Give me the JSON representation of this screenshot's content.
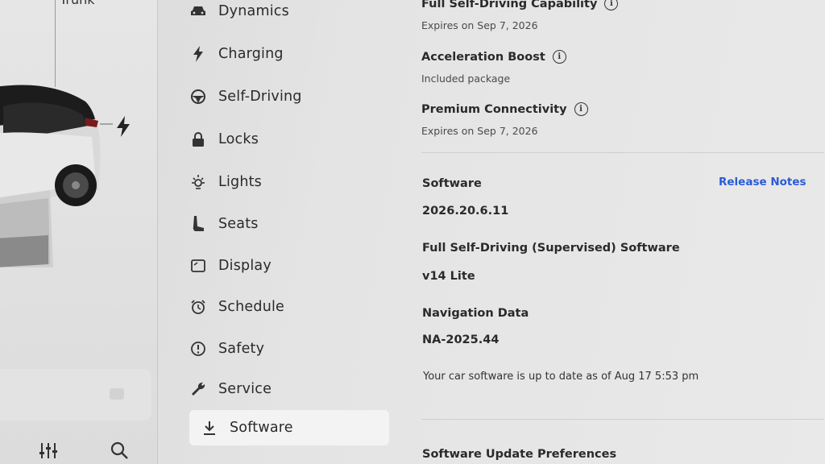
{
  "car_panel": {
    "trunk_label": "Trunk",
    "bottom_icons": [
      "sliders-icon",
      "search-icon"
    ]
  },
  "menu": {
    "items": [
      {
        "label": "Dynamics",
        "icon": "car-icon",
        "active": false
      },
      {
        "label": "Charging",
        "icon": "bolt-icon",
        "active": false
      },
      {
        "label": "Self-Driving",
        "icon": "steering-wheel-icon",
        "active": false
      },
      {
        "label": "Locks",
        "icon": "lock-icon",
        "active": false
      },
      {
        "label": "Lights",
        "icon": "light-icon",
        "active": false
      },
      {
        "label": "Seats",
        "icon": "seat-icon",
        "active": false
      },
      {
        "label": "Display",
        "icon": "display-icon",
        "active": false
      },
      {
        "label": "Schedule",
        "icon": "alarm-clock-icon",
        "active": false
      },
      {
        "label": "Safety",
        "icon": "alert-circle-icon",
        "active": false
      },
      {
        "label": "Service",
        "icon": "wrench-icon",
        "active": false
      },
      {
        "label": "Software",
        "icon": "download-icon",
        "active": true
      }
    ]
  },
  "features": [
    {
      "title": "Full Self-Driving Capability",
      "subtitle": "Expires on Sep 7, 2026"
    },
    {
      "title": "Acceleration Boost",
      "subtitle": "Included package"
    },
    {
      "title": "Premium Connectivity",
      "subtitle": "Expires on Sep 7, 2026"
    }
  ],
  "software": {
    "label": "Software",
    "version": "2026.20.6.11",
    "release_notes_label": "Release Notes",
    "fsd_label": "Full Self-Driving (Supervised) Software",
    "fsd_version": "v14 Lite",
    "nav_label": "Navigation Data",
    "nav_version": "NA-2025.44",
    "status": "Your car software is up to date as of Aug 17 5:53 pm",
    "update_prefs_label": "Software Update Preferences"
  },
  "colors": {
    "link": "#2a5bd7",
    "active_bg": "#f3f3f3"
  }
}
